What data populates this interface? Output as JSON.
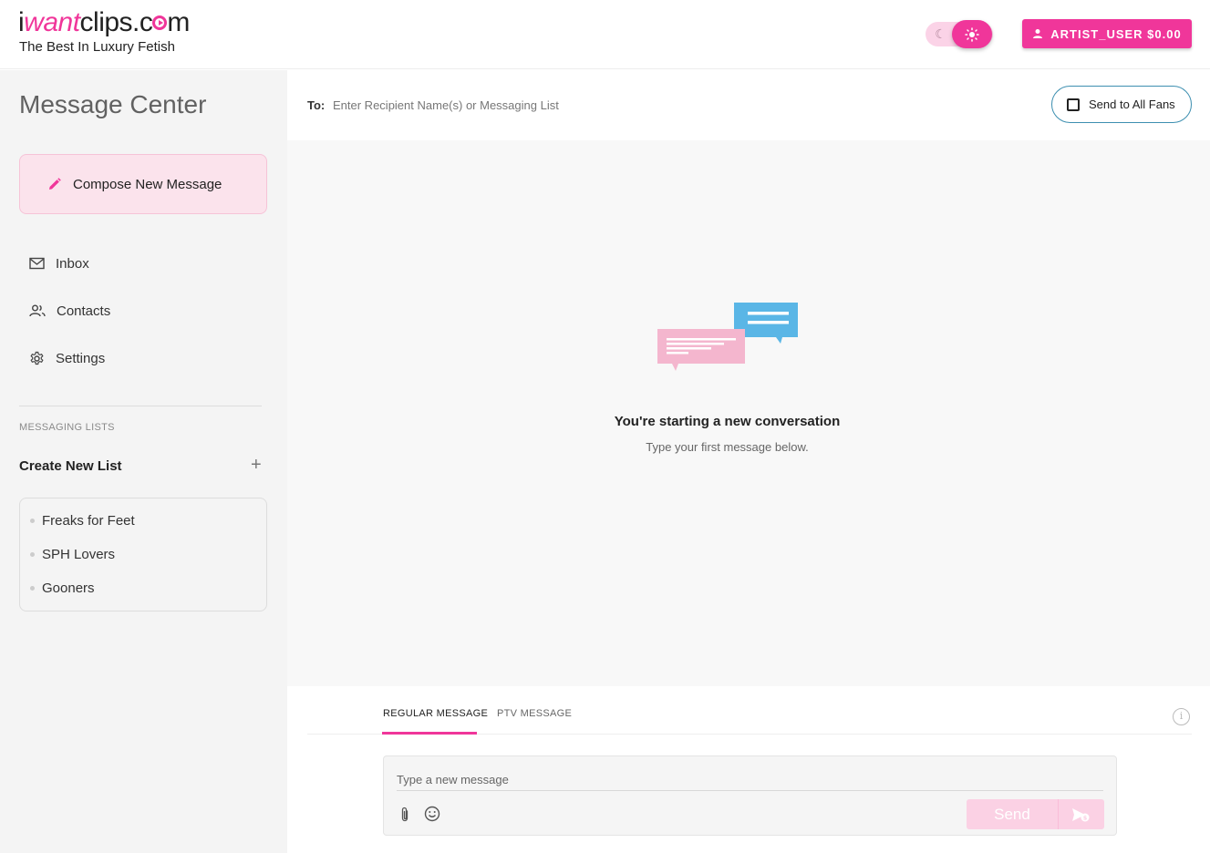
{
  "brand": {
    "logo_text_pre": "i",
    "logo_text_pink": "want",
    "logo_text_post": "clips.c",
    "logo_text_end": "m",
    "tagline": "The Best In Luxury Fetish",
    "accent_color": "#f0369a"
  },
  "header": {
    "theme_toggle": {
      "state": "light",
      "icons": [
        "moon-icon",
        "sun-icon"
      ]
    },
    "account_button_label": "ARTIST_USER $0.00"
  },
  "sidebar": {
    "title": "Message Center",
    "compose_label": "Compose New Message",
    "nav": [
      {
        "label": "Inbox",
        "icon": "mail-icon"
      },
      {
        "label": "Contacts",
        "icon": "contacts-icon"
      },
      {
        "label": "Settings",
        "icon": "gear-icon"
      }
    ],
    "messaging_lists_heading": "MESSAGING LISTS",
    "create_list_label": "Create New List",
    "lists": [
      "Freaks for Feet",
      "SPH Lovers",
      "Gooners"
    ]
  },
  "recipient": {
    "label": "To:",
    "placeholder": "Enter Recipient Name(s) or Messaging List",
    "send_all_label": "Send to All Fans",
    "send_all_checked": false
  },
  "conversation": {
    "title": "You're starting a new conversation",
    "subtitle": "Type your first message below."
  },
  "composer": {
    "tabs": [
      {
        "label": "REGULAR MESSAGE",
        "active": true
      },
      {
        "label": "PTV MESSAGE",
        "active": false
      }
    ],
    "placeholder": "Type a new message",
    "send_label": "Send"
  }
}
